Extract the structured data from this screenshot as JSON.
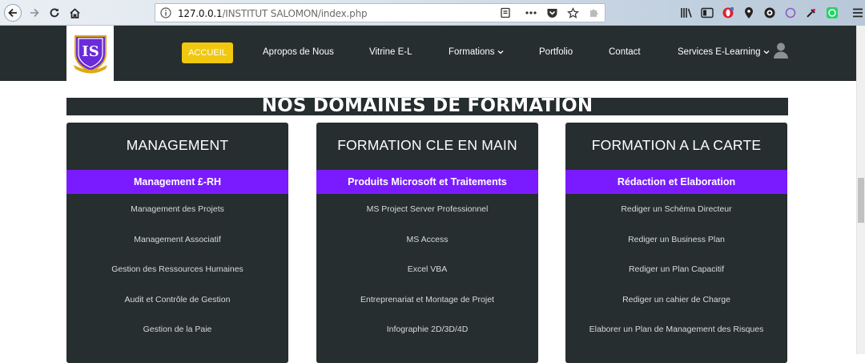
{
  "browser": {
    "url_host": "127.0.0.1",
    "url_path": "/INSTITUT SALOMON/index.php",
    "icons": [
      "back-icon",
      "forward-icon",
      "reload-icon",
      "home-icon",
      "info-icon",
      "reader-view-icon",
      "more-icon",
      "pocket-icon",
      "bookmark-star-icon",
      "extension-icon",
      "library-icon",
      "sidebar-icon",
      "opera-icon",
      "location-icon",
      "extension-icon",
      "extension-icon",
      "extension-icon",
      "whatsapp-icon",
      "menu-icon"
    ]
  },
  "header": {
    "logo_letters": "IS",
    "nav": {
      "accueil": "ACCUEIL",
      "apropos": "Apropos de Nous",
      "vitrine": "Vitrine E-L",
      "formations": "Formations",
      "portfolio": "Portfolio",
      "contact": "Contact",
      "services": "Services E-Learning"
    },
    "chevron": "⌄"
  },
  "section": {
    "title": "NOS DOMAINES DE FORMATION"
  },
  "cards": [
    {
      "title": "MANAGEMENT",
      "subtitle": "Management £-RH",
      "items": [
        "Management des Projets",
        "Management Associatif",
        "Gestion des Ressources Humaines",
        "Audit et Contrôle de Gestion",
        "Gestion de la Paie"
      ]
    },
    {
      "title": "FORMATION CLE EN MAIN",
      "subtitle": "Produits Microsoft et Traitements",
      "items": [
        "MS Project Server Professionnel",
        "MS Access",
        "Excel VBA",
        "Entreprenariat et Montage de Projet",
        "Infographie 2D/3D/4D"
      ]
    },
    {
      "title": "FORMATION A LA CARTE",
      "subtitle": "Rédaction et Elaboration",
      "items": [
        "Rediger un Schéma Directeur",
        "Rediger un Business Plan",
        "Rediger un Plan Capacitif",
        "Rediger un cahier de Charge",
        "Elaborer un Plan de Management des Risques"
      ]
    }
  ],
  "colors": {
    "header_bg": "#262e30",
    "accent_yellow": "#f0c80f",
    "accent_purple": "#7a1bff",
    "logo_purple": "#6a2bd8",
    "logo_gold": "#e0a818"
  }
}
